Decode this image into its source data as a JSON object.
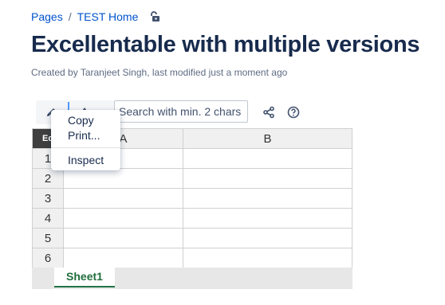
{
  "breadcrumb": {
    "items": [
      "Pages",
      "TEST Home"
    ],
    "separator": "/"
  },
  "page": {
    "title": "Excellentable with multiple versions",
    "byline": "Created by Taranjeet Singh, last modified just a moment ago"
  },
  "toolbar": {
    "edit_icon": "pencil-icon",
    "expand_icon": "expand-icon",
    "search_placeholder": "Search with min. 2 chars",
    "share_icon": "share-icon",
    "help_icon": "help-icon"
  },
  "spreadsheet": {
    "corner_label": "Ed",
    "columns": [
      "A",
      "B"
    ],
    "rows": [
      "1",
      "2",
      "3",
      "4",
      "5",
      "6"
    ],
    "sheet_tabs": [
      "Sheet1"
    ]
  },
  "context_menu": {
    "items": [
      "Copy",
      "Print...",
      "Inspect"
    ]
  },
  "colors": {
    "link": "#0052cc",
    "text": "#172b4d",
    "accent": "#4c9aff",
    "sheet_tab": "#1f6d3c"
  }
}
